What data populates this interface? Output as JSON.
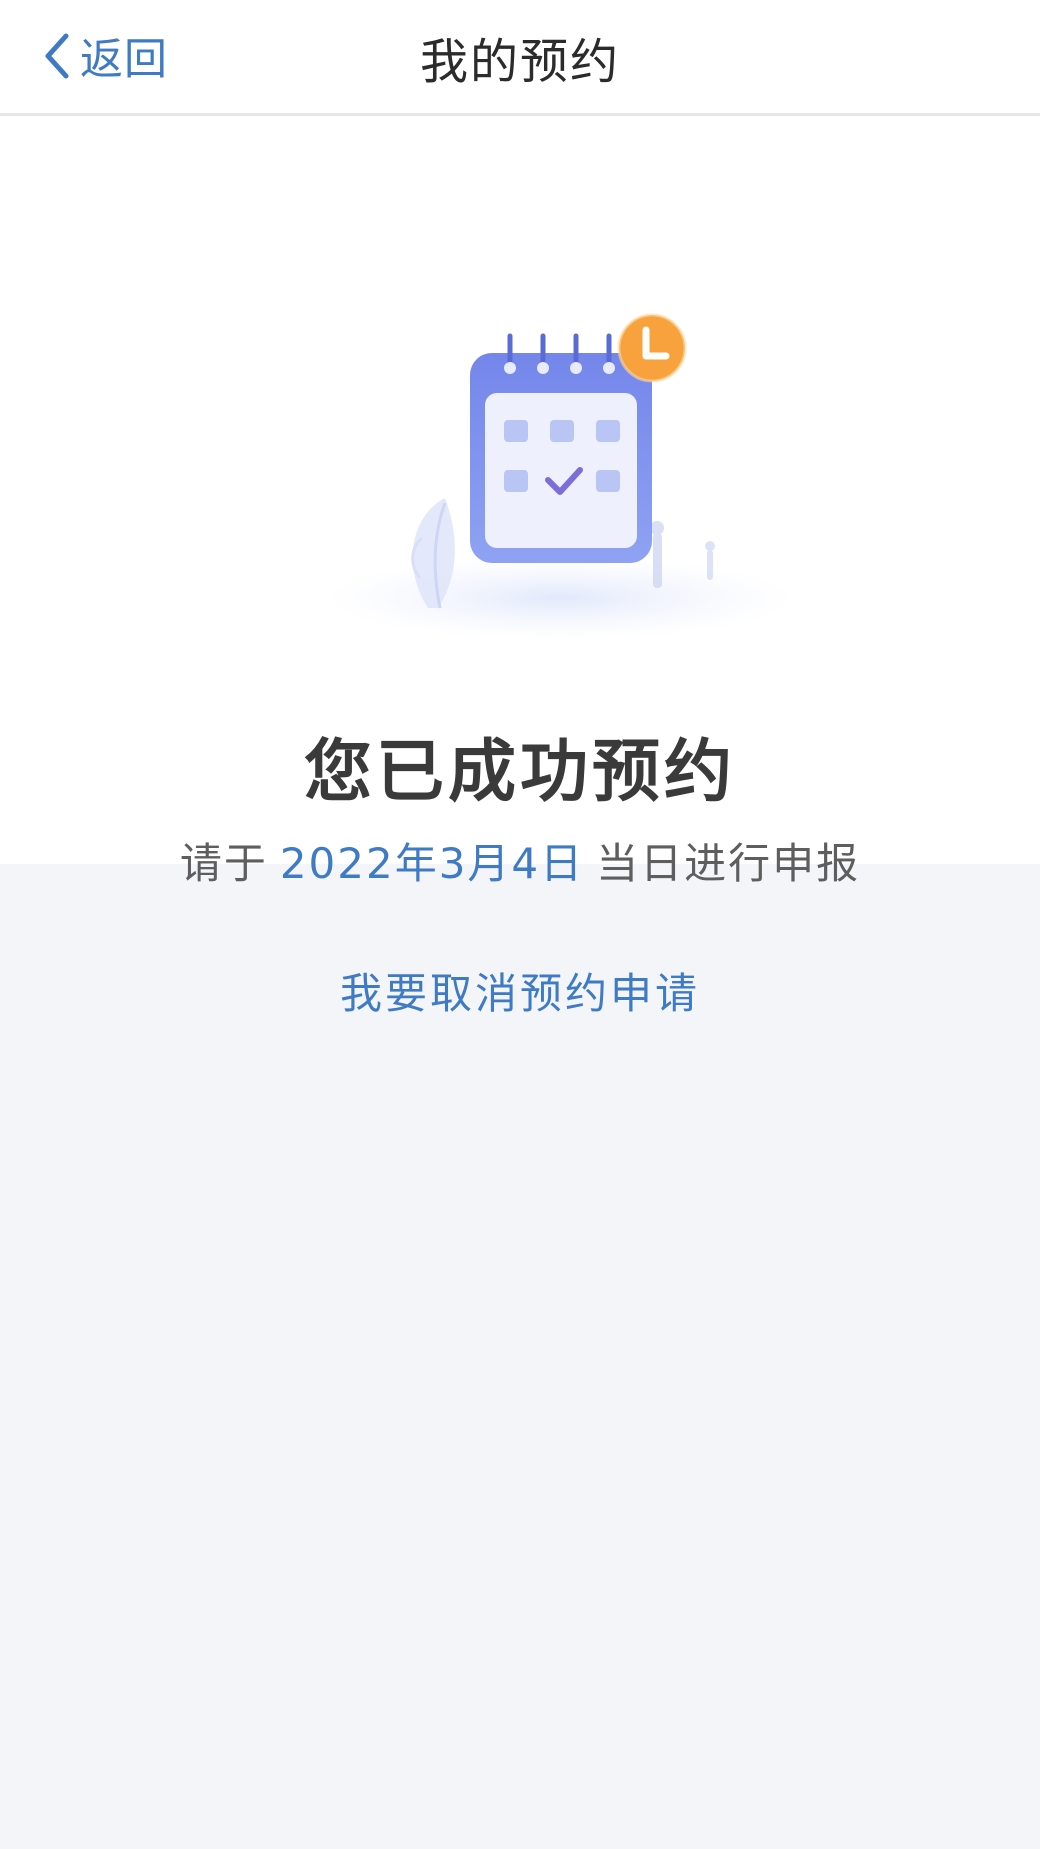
{
  "nav": {
    "back_label": "返回",
    "title": "我的预约"
  },
  "result": {
    "headline": "您已成功预约",
    "sub_prefix": "请于",
    "date": "2022年3月4日",
    "sub_suffix": "当日进行申报"
  },
  "actions": {
    "cancel_label": "我要取消预约申请"
  },
  "colors": {
    "accent": "#3f7bc5",
    "page_bg": "#f4f5f9",
    "card_bg": "#ffffff",
    "calendar": "#6f86e8",
    "clock_badge": "#f7a23c"
  },
  "icons": {
    "back": "chevron-left-icon",
    "illustration": "calendar-check-clock-illustration"
  }
}
